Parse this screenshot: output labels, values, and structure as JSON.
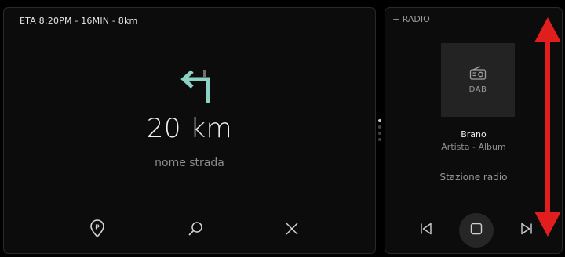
{
  "navigation": {
    "eta": "ETA 8:20PM - 16MIN - 8km",
    "distance": "20 km",
    "street": "nome strada",
    "turn_icon": "turn-left-arrow-icon",
    "turn_color": "#8cd3c3",
    "actions": [
      "parking-icon",
      "search-icon",
      "close-icon"
    ]
  },
  "radio": {
    "title": "+ RADIO",
    "source": "DAB",
    "track": "Brano",
    "artist_album": "Artista - Album",
    "station": "Stazione radio",
    "controls": [
      "previous-icon",
      "stop-icon",
      "next-icon"
    ]
  },
  "annotation": {
    "color": "#e01e1e",
    "shape": "double-headed-vertical-arrow"
  }
}
